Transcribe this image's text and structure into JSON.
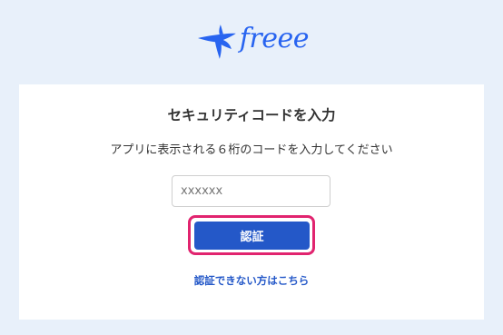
{
  "logo": {
    "text": "freee",
    "icon": "bird-icon",
    "brand_color": "#2864f0"
  },
  "card": {
    "title": "セキュリティコードを入力",
    "description": "アプリに表示される６桁のコードを入力してください",
    "code_input": {
      "value": "",
      "placeholder": "xxxxxx"
    },
    "submit_label": "認証",
    "help_link": "認証できない方はこちら"
  },
  "colors": {
    "background": "#e8f0fa",
    "button": "#2458c8",
    "focus_ring": "#e1246f",
    "link": "#2458c8"
  }
}
